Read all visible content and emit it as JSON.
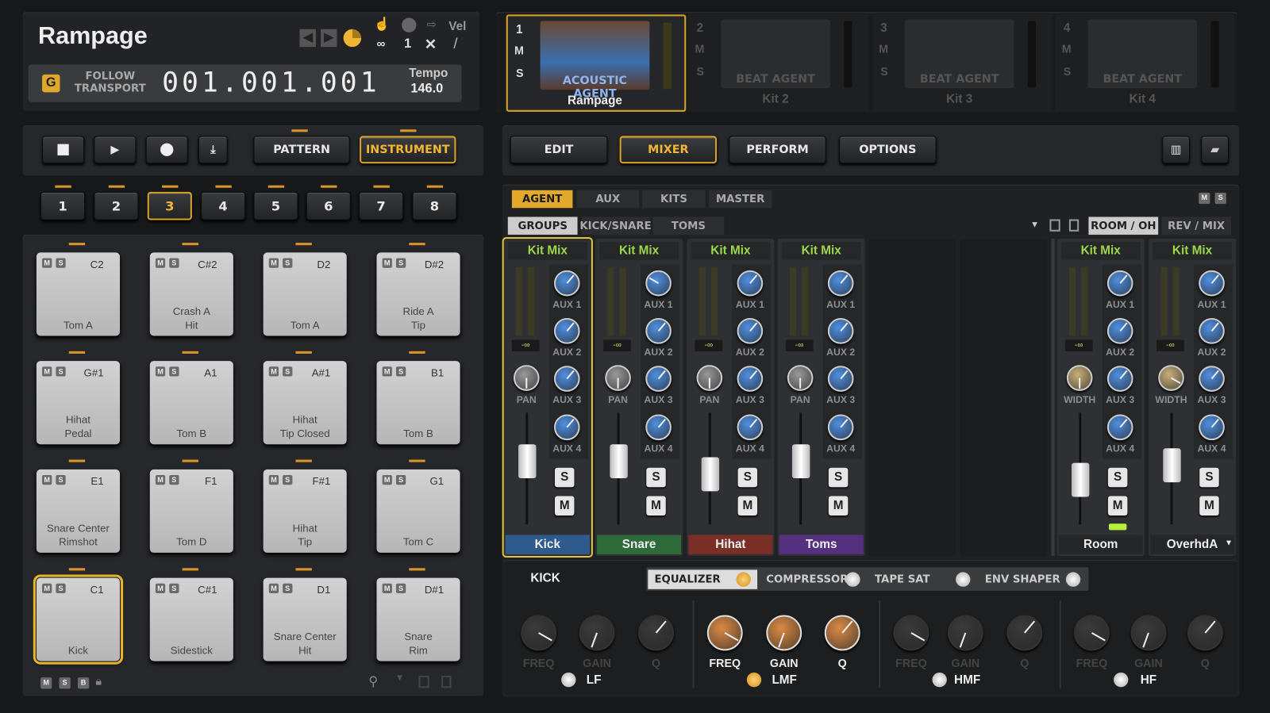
{
  "header": {
    "title": "Rampage",
    "follow_transport": "FOLLOW\nTRANSPORT",
    "position_display": "001.001.001",
    "tempo_label": "Tempo",
    "tempo_value": "146.0",
    "loop_symbol": "∞",
    "midi_channel": "1",
    "vel_label": "Vel",
    "close_symbol": "✕",
    "vel_curve": "/"
  },
  "transport": {
    "pattern_label": "PATTERN",
    "instrument_label": "INSTRUMENT",
    "active": "INSTRUMENT"
  },
  "banks": {
    "items": [
      "1",
      "2",
      "3",
      "4",
      "5",
      "6",
      "7",
      "8"
    ],
    "active": "3"
  },
  "pads": [
    {
      "note": "C2",
      "label": "Tom A"
    },
    {
      "note": "C#2",
      "label": "Crash A\nHit"
    },
    {
      "note": "D2",
      "label": "Tom A"
    },
    {
      "note": "D#2",
      "label": "Ride A\nTip"
    },
    {
      "note": "G#1",
      "label": "Hihat\nPedal"
    },
    {
      "note": "A1",
      "label": "Tom B"
    },
    {
      "note": "A#1",
      "label": "Hihat\nTip Closed"
    },
    {
      "note": "B1",
      "label": "Tom B"
    },
    {
      "note": "E1",
      "label": "Snare Center\nRimshot"
    },
    {
      "note": "F1",
      "label": "Tom D"
    },
    {
      "note": "F#1",
      "label": "Hihat\nTip"
    },
    {
      "note": "G1",
      "label": "Tom C"
    },
    {
      "note": "C1",
      "label": "Kick",
      "selected": true
    },
    {
      "note": "C#1",
      "label": "Sidestick"
    },
    {
      "note": "D1",
      "label": "Snare Center\nHit"
    },
    {
      "note": "D#1",
      "label": "Snare\nRim"
    }
  ],
  "pad_footer": {
    "m": "M",
    "s": "S",
    "b": "B"
  },
  "kit_slots": [
    {
      "number": "1",
      "agent": "ACOUSTIC AGENT",
      "name": "Rampage",
      "active": true
    },
    {
      "number": "2",
      "agent": "BEAT AGENT",
      "name": "Kit 2"
    },
    {
      "number": "3",
      "agent": "BEAT AGENT",
      "name": "Kit 3"
    },
    {
      "number": "4",
      "agent": "BEAT AGENT",
      "name": "Kit 4"
    }
  ],
  "nav": {
    "items": [
      "EDIT",
      "MIXER",
      "PERFORM",
      "OPTIONS"
    ],
    "active": "MIXER"
  },
  "mixer_tabs": {
    "items": [
      "AGENT",
      "AUX",
      "KITS",
      "MASTER"
    ],
    "active": "AGENT"
  },
  "group_tabs": {
    "items": [
      "GROUPS",
      "KICK/SNARE",
      "TOMS"
    ],
    "active": "GROUPS",
    "right_items": [
      "ROOM / OH",
      "REV / MIX"
    ],
    "right_active": "ROOM / OH"
  },
  "channels": [
    {
      "name": "Kick",
      "output": "Kit Mix",
      "level": "-∞",
      "knob2": "PAN",
      "color": "#2f5a8e",
      "fader": 0.72,
      "selected": true
    },
    {
      "name": "Snare",
      "output": "Kit Mix",
      "level": "-∞",
      "knob2": "PAN",
      "color": "#2e6a3a",
      "fader": 0.72
    },
    {
      "name": "Hihat",
      "output": "Kit Mix",
      "level": "-∞",
      "knob2": "PAN",
      "color": "#7a2f26",
      "fader": 0.6
    },
    {
      "name": "Toms",
      "output": "Kit Mix",
      "level": "-∞",
      "knob2": "PAN",
      "color": "#55307e",
      "fader": 0.72
    },
    {
      "name": "Room",
      "output": "Kit Mix",
      "level": "-∞",
      "knob2": "WIDTH",
      "color": "#252628",
      "fader": 0.55,
      "solo_led": true
    },
    {
      "name": "OverhdA",
      "output": "Kit Mix",
      "level": "-∞",
      "knob2": "WIDTH",
      "color": "#252628",
      "fader": 0.68,
      "dropdown": true
    }
  ],
  "aux_labels": [
    "AUX 1",
    "AUX 2",
    "AUX 3",
    "AUX 4"
  ],
  "solo_label": "S",
  "mute_label": "M",
  "fx": {
    "channel": "KICK",
    "tabs": [
      "EQUALIZER",
      "COMPRESSOR",
      "TAPE SAT",
      "ENV SHAPER"
    ],
    "active": "EQUALIZER",
    "bands": [
      {
        "name": "LF",
        "enabled": false
      },
      {
        "name": "LMF",
        "enabled": true
      },
      {
        "name": "HMF",
        "enabled": false
      },
      {
        "name": "HF",
        "enabled": false
      }
    ],
    "knob_labels": [
      "FREQ",
      "GAIN",
      "Q"
    ]
  },
  "colors": {
    "accent": "#e3a92c",
    "kitmix": "#9bd84a",
    "aux_knob": "#3b76c4",
    "eq_knob": "#c97a3a"
  }
}
